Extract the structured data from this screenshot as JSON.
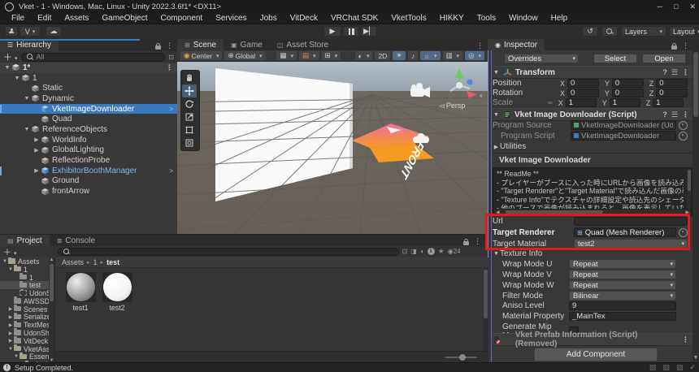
{
  "window": {
    "title": "Vket - 1 - Windows, Mac, Linux - Unity 2022.3.6f1* <DX11>",
    "controls": {
      "minimize": "─",
      "maximize": "□",
      "close": "✕"
    }
  },
  "menu": {
    "items": [
      "File",
      "Edit",
      "Assets",
      "GameObject",
      "Component",
      "Services",
      "Jobs",
      "VitDeck",
      "VRChat SDK",
      "VketTools",
      "HIKKY",
      "Tools",
      "Window",
      "Help"
    ]
  },
  "toolbar": {
    "version_button": "V",
    "layers_label": "Layers",
    "layout_label": "Layout"
  },
  "hierarchy": {
    "tab": "Hierarchy",
    "search_placeholder": "All",
    "rows": [
      {
        "label": "1*",
        "depth": 0,
        "arrow": "v",
        "icon": "unity",
        "scene": true
      },
      {
        "label": "1",
        "depth": 1,
        "arrow": "v",
        "icon": "cube"
      },
      {
        "label": "Static",
        "depth": 2,
        "arrow": "",
        "icon": "cube"
      },
      {
        "label": "Dynamic",
        "depth": 2,
        "arrow": "v",
        "icon": "cube"
      },
      {
        "label": "VketImageDownloader",
        "depth": 3,
        "arrow": "",
        "icon": "prefab",
        "selected": true,
        "chevron": true,
        "marker": true
      },
      {
        "label": "Quad",
        "depth": 3,
        "arrow": "",
        "icon": "cube"
      },
      {
        "label": "ReferenceObjects",
        "depth": 2,
        "arrow": "v",
        "icon": "cube"
      },
      {
        "label": "WorldInfo",
        "depth": 3,
        "arrow": ">",
        "icon": "cube"
      },
      {
        "label": "GlobalLighting",
        "depth": 3,
        "arrow": ">",
        "icon": "cube"
      },
      {
        "label": "ReflectionProbe",
        "depth": 3,
        "arrow": "",
        "icon": "cube"
      },
      {
        "label": "ExhibitorBoothManager",
        "depth": 3,
        "arrow": ">",
        "icon": "prefab",
        "blue": true,
        "chevron": true,
        "marker": true
      },
      {
        "label": "Ground",
        "depth": 3,
        "arrow": "",
        "icon": "cube"
      },
      {
        "label": "frontArrow",
        "depth": 3,
        "arrow": "",
        "icon": "cube"
      }
    ]
  },
  "scene": {
    "tabs": [
      "Scene",
      "Game",
      "Asset Store"
    ],
    "toolbar": {
      "pivot": "Center",
      "orientation": "Global",
      "mode_2d": "2D"
    },
    "persp_label": "Persp",
    "front_text": "FRONT",
    "axis_labels": {
      "x": "x",
      "y": "y"
    }
  },
  "inspector": {
    "tab": "Inspector",
    "overrides_label": "Overrides",
    "select_label": "Select",
    "open_label": "Open",
    "axes": [
      "X",
      "Y",
      "Z"
    ],
    "transform": {
      "title": "Transform",
      "rows": [
        {
          "label": "Position",
          "x": "0",
          "y": "0",
          "z": "0"
        },
        {
          "label": "Rotation",
          "x": "0",
          "y": "0",
          "z": "0"
        },
        {
          "label": "Scale",
          "x": "1",
          "y": "1",
          "z": "1",
          "linked": true
        }
      ]
    },
    "script": {
      "title": "Vket Image Downloader (Script)",
      "program_source_label": "Program Source",
      "program_source_value": "VketImageDownloader (Udon Sharp",
      "program_script_label": "Program Script",
      "program_script_value": "VketImageDownloader",
      "utilities_label": "Utilities",
      "readme_title": "Vket Image Downloader",
      "readme_lines": [
        "** ReadMe **",
        "- プレイヤーがブースに入った時にURLから画像を読み込みます。",
        "- \"Target Renderer\"と\"Target Material\"で読み込んだ画像の表示先を指",
        "- \"Texture Info\"でテクスチャの詳細設定や読込先のシェーダープロパティを設定",
        "- 他のブースで画像が読み込まれると、画像を表示していたRendererは読み込ま"
      ],
      "url_label": "Url",
      "url_value": "",
      "target_renderer_label": "Target Renderer",
      "target_renderer_value": "Quad (Mesh Renderer)",
      "target_material_label": "Target Material",
      "target_material_value": "test2",
      "texture_info_label": "Texture Info",
      "texture_rows": [
        {
          "label": "Wrap Mode U",
          "value": "Repeat"
        },
        {
          "label": "Wrap Mode V",
          "value": "Repeat"
        },
        {
          "label": "Wrap Mode W",
          "value": "Repeat"
        },
        {
          "label": "Filter Mode",
          "value": "Bilinear"
        },
        {
          "label": "Aniso Level",
          "value": "9"
        },
        {
          "label": "Material Property",
          "value": "_MainTex"
        },
        {
          "label": "Generate Mip Maps",
          "value": ""
        }
      ]
    },
    "removed_component": "Vket Prefab Information (Script) (Removed)",
    "add_component_label": "Add Component"
  },
  "project": {
    "tabs": [
      "Project",
      "Console"
    ],
    "breadcrumb": [
      "Assets",
      "1",
      "test"
    ],
    "tree": [
      {
        "label": "Assets",
        "depth": 0,
        "arrow": "v",
        "open": true
      },
      {
        "label": "1",
        "depth": 1,
        "arrow": "v",
        "open": true
      },
      {
        "label": "1",
        "depth": 2,
        "arrow": ""
      },
      {
        "label": "test",
        "depth": 2,
        "arrow": "",
        "selected": true
      },
      {
        "label": "UdonS",
        "depth": 2,
        "arrow": "",
        "empty": true
      },
      {
        "label": "AWSSDK",
        "depth": 1,
        "arrow": ""
      },
      {
        "label": "Scenes",
        "depth": 1,
        "arrow": ">"
      },
      {
        "label": "Serialize",
        "depth": 1,
        "arrow": ">"
      },
      {
        "label": "TextMes",
        "depth": 1,
        "arrow": ">"
      },
      {
        "label": "UdonSha",
        "depth": 1,
        "arrow": ">"
      },
      {
        "label": "VitDeck",
        "depth": 1,
        "arrow": ">"
      },
      {
        "label": "VketAsse",
        "depth": 1,
        "arrow": "v",
        "open": true
      },
      {
        "label": "Essent",
        "depth": 2,
        "arrow": "v",
        "open": true
      },
      {
        "label": "Attri",
        "depth": 3,
        "arrow": ""
      }
    ],
    "assets": [
      {
        "name": "test1",
        "kind": "gray"
      },
      {
        "name": "test2",
        "kind": "white"
      }
    ],
    "hidden_count": "24"
  },
  "statusbar": {
    "message": "Setup Completed."
  },
  "colors": {
    "selection_blue": "#3a79bb",
    "annotation_red": "#e01b1b",
    "arrow_orange": "#f59b23",
    "arrow_pink": "#ee6fa2",
    "prefab_blue": "#6fa8dc"
  }
}
